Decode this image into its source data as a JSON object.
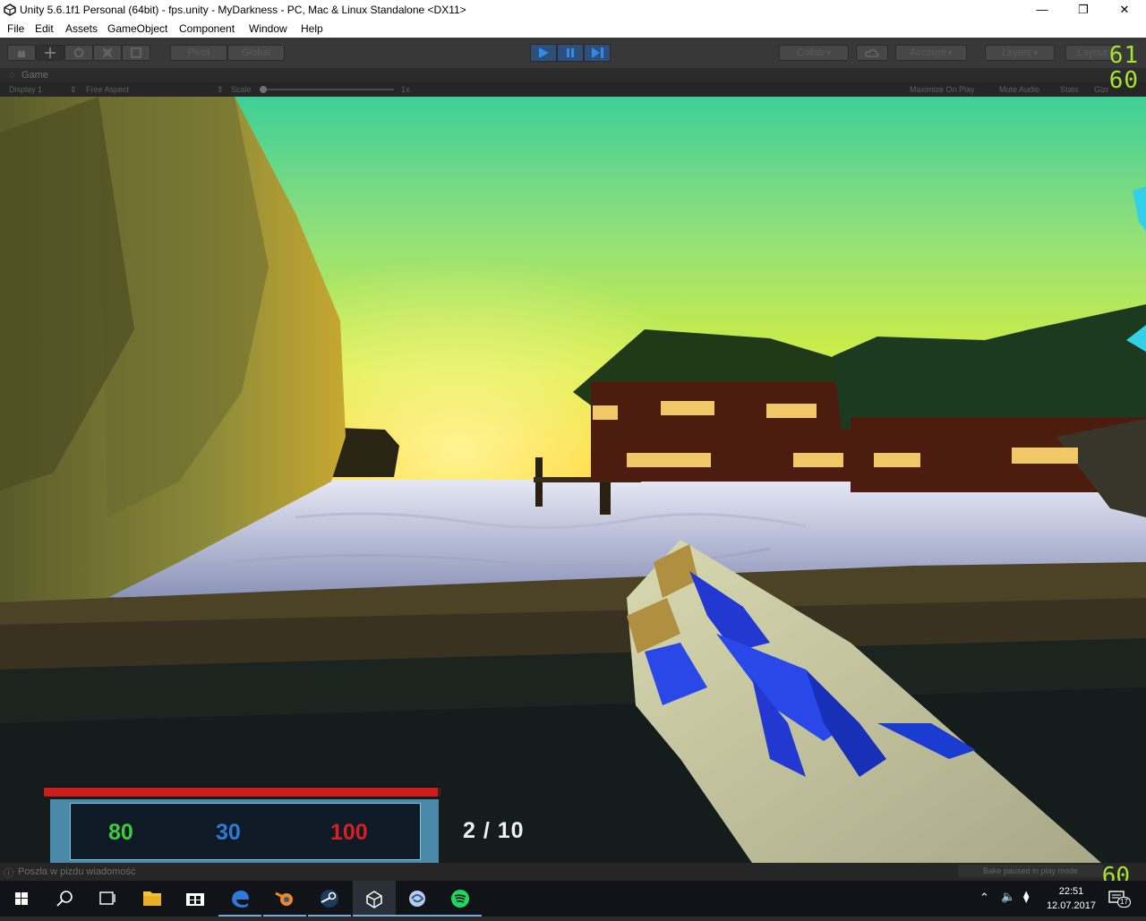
{
  "window": {
    "title": "Unity 5.6.1f1 Personal (64bit) - fps.unity - MyDarkness - PC, Mac & Linux Standalone <DX11>",
    "controls": [
      "minimize-icon",
      "restore-icon",
      "close-icon"
    ]
  },
  "menu": [
    "File",
    "Edit",
    "Assets",
    "GameObject",
    "Component",
    "Window",
    "Help"
  ],
  "toolbar": {
    "tools": [
      "hand-icon",
      "move-icon",
      "rotate-icon",
      "scale-icon",
      "rect-tool-icon"
    ],
    "pivot": "Pivot",
    "global": "Global",
    "play_buttons": [
      "play-icon",
      "pause-icon",
      "step-icon"
    ],
    "collab": "Collab",
    "account": "Account",
    "layers": "Layers",
    "layout": "Layout"
  },
  "fps": {
    "top_value": "61",
    "bottom_value": "60",
    "lower_value": "60"
  },
  "game_view": {
    "tab_label": "Game",
    "display": "Display 1",
    "aspect": "Free Aspect",
    "scale_label": "Scale",
    "scale_value": "1x",
    "scale_level": 0,
    "maximize": "Maximize On Play",
    "mute": "Mute Audio",
    "stats": "Stats",
    "gizmos": "Gizmos"
  },
  "hud": {
    "health_level": 0.99,
    "stat_green": "80",
    "stat_blue": "30",
    "stat_red": "100",
    "ammo": "2 / 10",
    "colors": {
      "green": "#3dcc3d",
      "blue": "#2f7ad8",
      "red": "#d42020",
      "health": "#cc1c1c",
      "panel": "#4a8aa8"
    }
  },
  "status": {
    "message": "Poszła w pizdu wiadomość",
    "bake": "Bake paused in play mode"
  },
  "taskbar": {
    "apps": [
      "start-icon",
      "search-icon",
      "task-view-icon",
      "file-explorer-icon",
      "store-icon",
      "edge-icon",
      "blender-icon",
      "steam-icon",
      "unity-icon",
      "app-icon",
      "spotify-icon"
    ],
    "time": "22:51",
    "date": "12.07.2017",
    "notifications": "17"
  }
}
